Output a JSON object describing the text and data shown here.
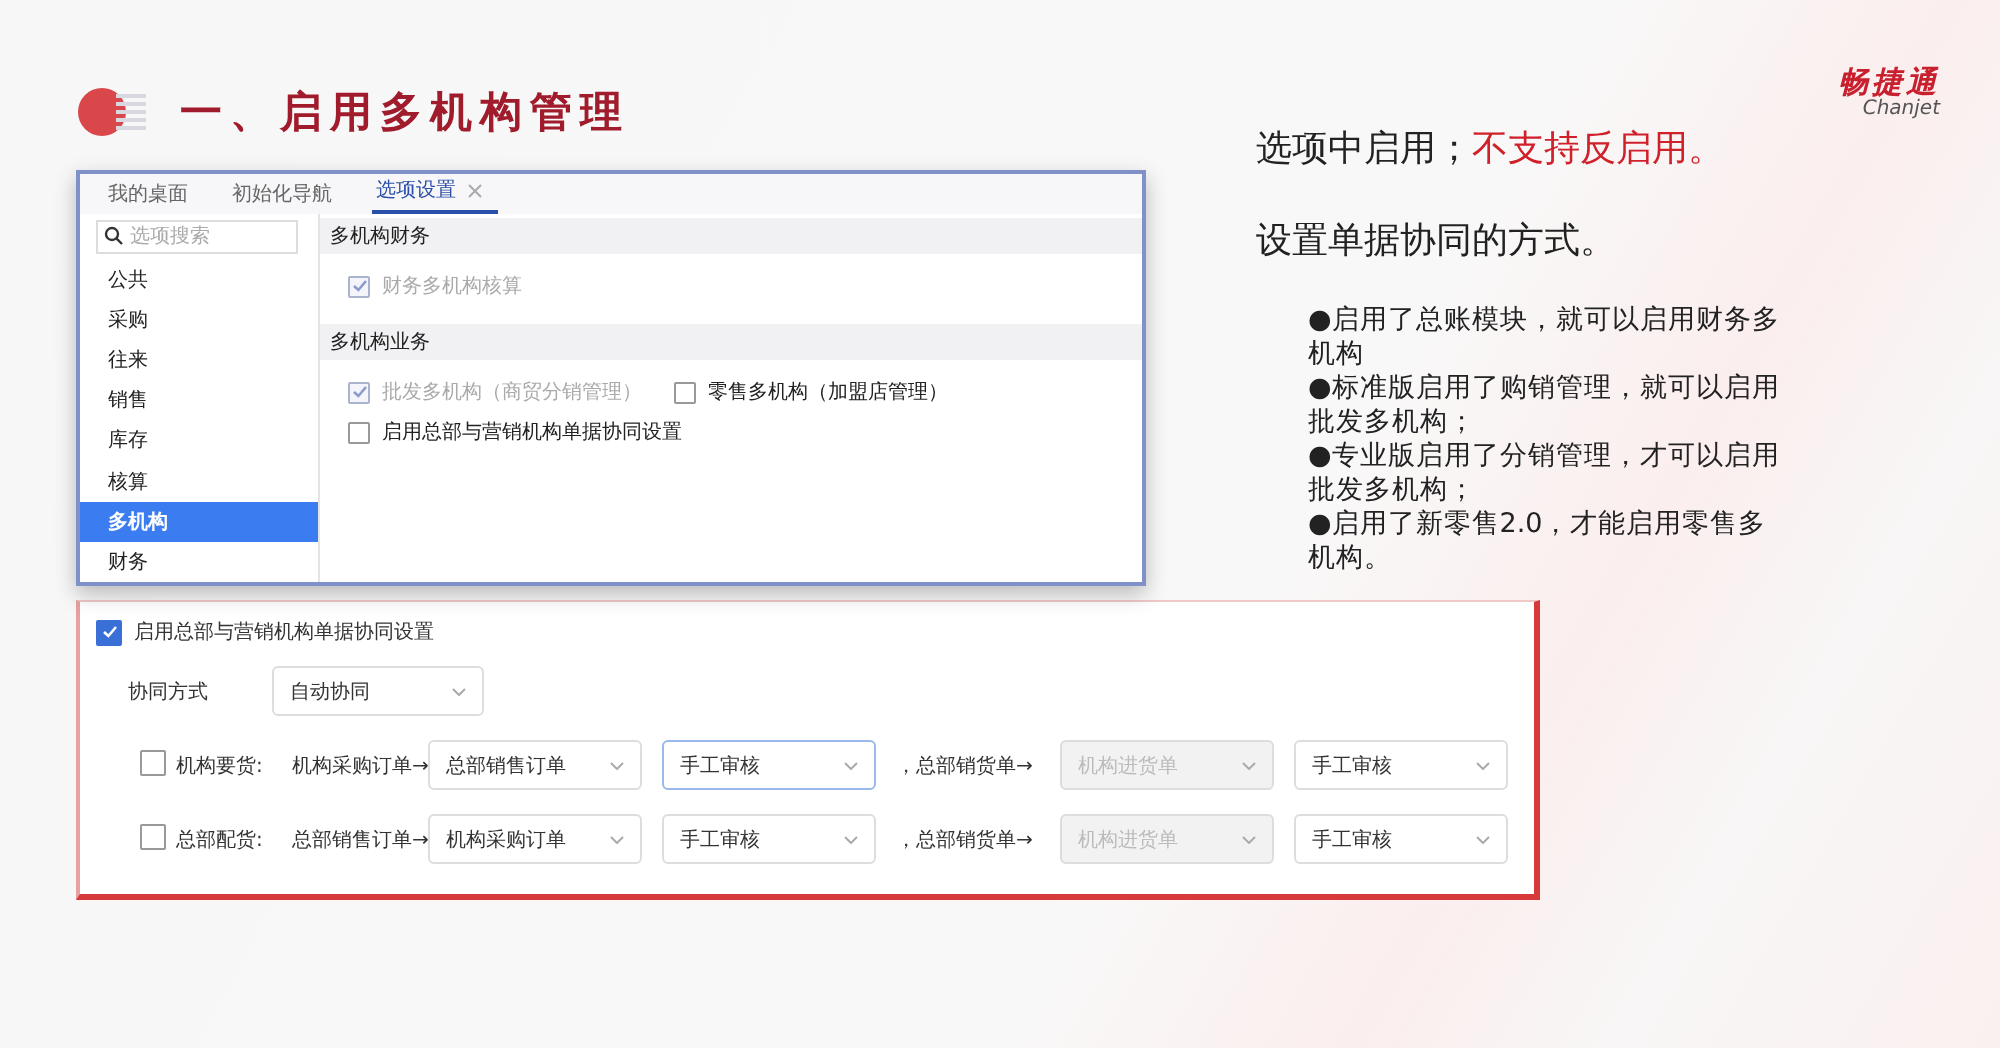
{
  "title": "一、启用多机构管理",
  "logo": {
    "name": "畅捷通",
    "latin": "Chanjet"
  },
  "window": {
    "tabs": [
      {
        "label": "我的桌面",
        "selected": false,
        "closable": false
      },
      {
        "label": "初始化导航",
        "selected": false,
        "closable": false
      },
      {
        "label": "选项设置",
        "selected": true,
        "closable": true
      }
    ],
    "search": {
      "placeholder": "选项搜索"
    },
    "sidebar": {
      "items": [
        {
          "label": "公共",
          "selected": false
        },
        {
          "label": "采购",
          "selected": false
        },
        {
          "label": "往来",
          "selected": false
        },
        {
          "label": "销售",
          "selected": false
        },
        {
          "label": "库存",
          "selected": false
        },
        {
          "label": "核算",
          "selected": false
        },
        {
          "label": "多机构",
          "selected": true
        },
        {
          "label": "财务",
          "selected": false
        }
      ]
    },
    "sections": [
      {
        "heading": "多机构财务",
        "rows": [
          [
            {
              "label": "财务多机构核算",
              "checked": true,
              "disabled": true
            }
          ]
        ]
      },
      {
        "heading": "多机构业务",
        "rows": [
          [
            {
              "label": "批发多机构（商贸分销管理）",
              "checked": true,
              "disabled": true
            },
            {
              "label": "零售多机构（加盟店管理）",
              "checked": false,
              "disabled": false
            }
          ],
          [
            {
              "label": "启用总部与营销机构单据协同设置",
              "checked": false,
              "disabled": false
            }
          ]
        ]
      }
    ]
  },
  "notes": {
    "intro": [
      {
        "text": "选项中启用；",
        "emphasis": false
      },
      {
        "text": "不支持反启用。",
        "emphasis": true
      }
    ],
    "subtitle": "设置单据协同的方式。",
    "bullets": [
      "●启用了总账模块，就可以启用财务多机构",
      "●标准版启用了购销管理，就可以启用批发多机构；",
      "●专业版启用了分销管理，才可以启用批发多机构；",
      "●启用了新零售2.0，才能启用零售多机构。"
    ]
  },
  "sync_panel": {
    "enable": {
      "label": "启用总部与营销机构单据协同设置",
      "checked": true
    },
    "mode": {
      "label": "协同方式",
      "value": "自动协同"
    },
    "rows": [
      {
        "cells": [
          {
            "kind": "checkbox",
            "checked": false
          },
          {
            "kind": "label",
            "text": "机构要货:"
          },
          {
            "kind": "label",
            "text": "机构采购订单→"
          },
          {
            "kind": "select",
            "value": "总部销售订单",
            "disabled": false,
            "focused": false
          },
          {
            "kind": "select",
            "value": "手工审核",
            "disabled": false,
            "focused": true
          },
          {
            "kind": "label",
            "text": "，总部销货单→"
          },
          {
            "kind": "select",
            "value": "机构进货单",
            "disabled": true,
            "focused": false
          },
          {
            "kind": "select",
            "value": "手工审核",
            "disabled": false,
            "focused": false
          }
        ]
      },
      {
        "cells": [
          {
            "kind": "checkbox",
            "checked": false
          },
          {
            "kind": "label",
            "text": "总部配货:"
          },
          {
            "kind": "label",
            "text": "总部销售订单→"
          },
          {
            "kind": "select",
            "value": "机构采购订单",
            "disabled": false,
            "focused": false
          },
          {
            "kind": "select",
            "value": "手工审核",
            "disabled": false,
            "focused": false
          },
          {
            "kind": "label",
            "text": "，总部销货单→"
          },
          {
            "kind": "select",
            "value": "机构进货单",
            "disabled": true,
            "focused": false
          },
          {
            "kind": "select",
            "value": "手工审核",
            "disabled": false,
            "focused": false
          }
        ]
      }
    ]
  }
}
